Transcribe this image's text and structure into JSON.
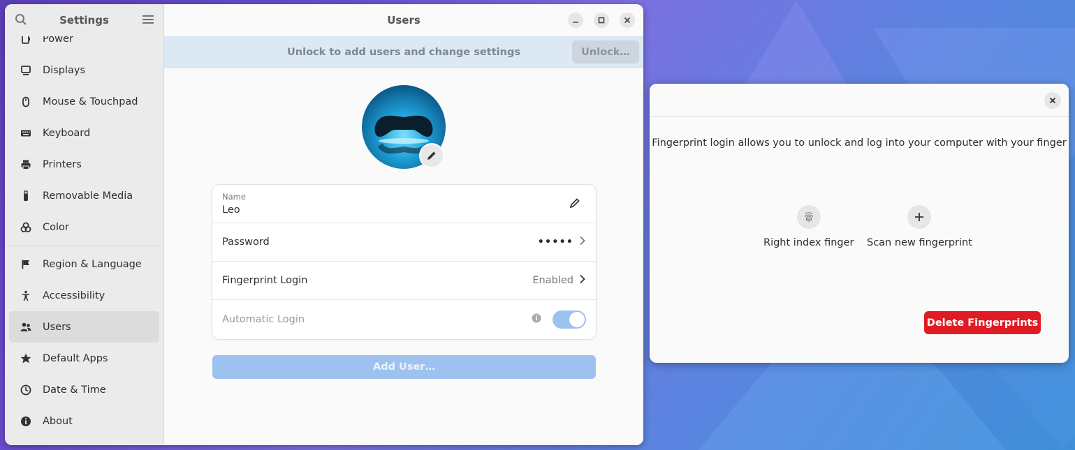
{
  "sidebar": {
    "title": "Settings",
    "items": [
      {
        "label": "Power",
        "icon": "power-icon"
      },
      {
        "label": "Displays",
        "icon": "display-icon"
      },
      {
        "label": "Mouse & Touchpad",
        "icon": "mouse-icon"
      },
      {
        "label": "Keyboard",
        "icon": "keyboard-icon"
      },
      {
        "label": "Printers",
        "icon": "printer-icon"
      },
      {
        "label": "Removable Media",
        "icon": "usb-icon"
      },
      {
        "label": "Color",
        "icon": "color-icon"
      },
      {
        "label": "Region & Language",
        "icon": "flag-icon"
      },
      {
        "label": "Accessibility",
        "icon": "accessibility-icon"
      },
      {
        "label": "Users",
        "icon": "users-icon"
      },
      {
        "label": "Default Apps",
        "icon": "star-icon"
      },
      {
        "label": "Date & Time",
        "icon": "clock-icon"
      },
      {
        "label": "About",
        "icon": "info-icon"
      }
    ]
  },
  "main": {
    "title": "Users",
    "unlock_message": "Unlock to add users and change settings",
    "unlock_button": "Unlock…",
    "name_label": "Name",
    "name_value": "Leo",
    "password_label": "Password",
    "password_value": "•••••",
    "fingerprint_label": "Fingerprint Login",
    "fingerprint_value": "Enabled",
    "autologin_label": "Automatic Login",
    "add_user_button": "Add User…"
  },
  "dialog": {
    "description": "Fingerprint login allows you to unlock and log into your computer with your finger",
    "enrolled_finger": "Right index finger",
    "scan_new": "Scan new fingerprint",
    "delete_button": "Delete Fingerprints"
  },
  "colors": {
    "accent": "#9ec2ef",
    "destructive": "#e01b24",
    "unlock_bar": "#dde8f5"
  }
}
